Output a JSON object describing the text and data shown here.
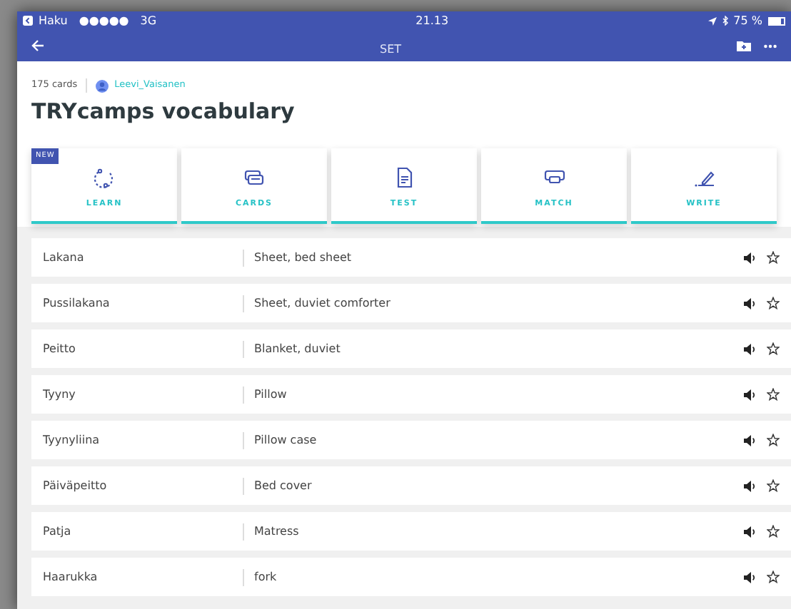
{
  "status_bar": {
    "carrier": "Haku",
    "signal": "●●●●●",
    "network": "3G",
    "time": "21.13",
    "battery": "75 %"
  },
  "nav_bar": {
    "title": "SET"
  },
  "set": {
    "card_count": "175 cards",
    "author": "Leevi_Vaisanen",
    "title": "TRYcamps vocabulary"
  },
  "modes": [
    {
      "kind": "learn",
      "label": "LEARN",
      "badge": "NEW"
    },
    {
      "kind": "cards",
      "label": "CARDS"
    },
    {
      "kind": "test",
      "label": "TEST"
    },
    {
      "kind": "match",
      "label": "MATCH"
    },
    {
      "kind": "write",
      "label": "WRITE"
    }
  ],
  "terms": [
    {
      "term": "Lakana",
      "definition": "Sheet, bed sheet",
      "starred": false
    },
    {
      "term": "Pussilakana",
      "definition": "Sheet, duviet comforter",
      "starred": false
    },
    {
      "term": "Peitto",
      "definition": "Blanket, duviet",
      "starred": false
    },
    {
      "term": "Tyyny",
      "definition": "Pillow",
      "starred": false
    },
    {
      "term": "Tyynyliina",
      "definition": "Pillow case",
      "starred": false
    },
    {
      "term": "Päiväpeitto",
      "definition": "Bed cover",
      "starred": false
    },
    {
      "term": "Patja",
      "definition": "Matress",
      "starred": false
    },
    {
      "term": "Haarukka",
      "definition": "fork",
      "starred": false
    }
  ]
}
